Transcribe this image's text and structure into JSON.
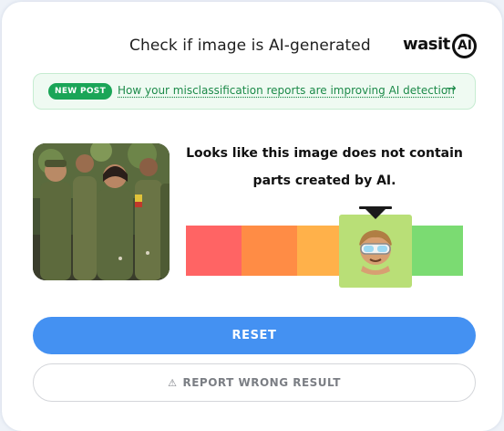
{
  "header": {
    "title": "Check if image is AI-generated",
    "logo_text": "wasit",
    "logo_badge": "AI"
  },
  "banner": {
    "badge": "NEW POST",
    "link_text": "How your misclassification reports are improving AI detection",
    "arrow": "→"
  },
  "result": {
    "message": "Looks like this image does not contain parts created by AI.",
    "scale_colors": [
      "#ff6464",
      "#ff8c45",
      "#ffb14a",
      "#b9df77",
      "#7bdb72"
    ],
    "selected_segment": 4,
    "selected_segment_count": 5,
    "indicator_icon": "avatar-with-vr-goggles-icon"
  },
  "image": {
    "description_icon": "uploaded-photo"
  },
  "actions": {
    "reset_label": "RESET",
    "report_label": "REPORT WRONG RESULT",
    "report_icon": "warning-triangle-icon"
  }
}
